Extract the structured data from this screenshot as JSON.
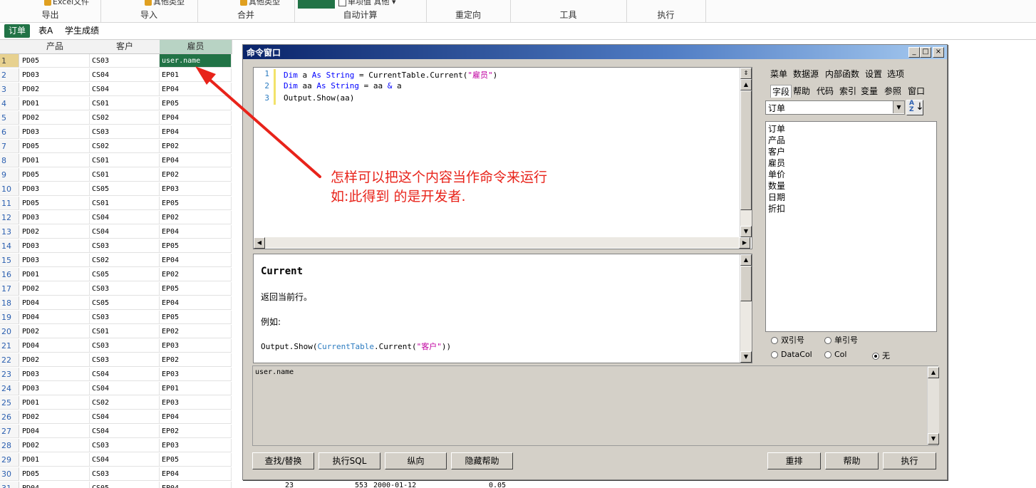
{
  "ribbon": {
    "groups": [
      {
        "label": "导出",
        "top_text": "Excel文件"
      },
      {
        "label": "导入",
        "top_text": "其他类型"
      },
      {
        "label": "合并",
        "top_text": "其他类型"
      },
      {
        "label": "自动计算",
        "top_text": "单项值 其他"
      },
      {
        "label": "重定向",
        "top_text": ""
      },
      {
        "label": "工具",
        "top_text": ""
      },
      {
        "label": "执行",
        "top_text": ""
      }
    ]
  },
  "tabs": [
    {
      "label": "订单",
      "active": true
    },
    {
      "label": "表A",
      "active": false
    },
    {
      "label": "学生成绩",
      "active": false
    }
  ],
  "grid": {
    "columns": [
      "产品",
      "客户",
      "雇员"
    ],
    "selected_column": "雇员",
    "rows": [
      {
        "n": "1",
        "product": "PD05",
        "customer": "CS03",
        "employee": "user.name"
      },
      {
        "n": "2",
        "product": "PD03",
        "customer": "CS04",
        "employee": "EP01"
      },
      {
        "n": "3",
        "product": "PD02",
        "customer": "CS04",
        "employee": "EP04"
      },
      {
        "n": "4",
        "product": "PD01",
        "customer": "CS01",
        "employee": "EP05"
      },
      {
        "n": "5",
        "product": "PD02",
        "customer": "CS02",
        "employee": "EP04"
      },
      {
        "n": "6",
        "product": "PD03",
        "customer": "CS03",
        "employee": "EP04"
      },
      {
        "n": "7",
        "product": "PD05",
        "customer": "CS02",
        "employee": "EP02"
      },
      {
        "n": "8",
        "product": "PD01",
        "customer": "CS01",
        "employee": "EP04"
      },
      {
        "n": "9",
        "product": "PD05",
        "customer": "CS01",
        "employee": "EP02"
      },
      {
        "n": "10",
        "product": "PD03",
        "customer": "CS05",
        "employee": "EP03"
      },
      {
        "n": "11",
        "product": "PD05",
        "customer": "CS01",
        "employee": "EP05"
      },
      {
        "n": "12",
        "product": "PD03",
        "customer": "CS04",
        "employee": "EP02"
      },
      {
        "n": "13",
        "product": "PD02",
        "customer": "CS04",
        "employee": "EP04"
      },
      {
        "n": "14",
        "product": "PD03",
        "customer": "CS03",
        "employee": "EP05"
      },
      {
        "n": "15",
        "product": "PD03",
        "customer": "CS02",
        "employee": "EP04"
      },
      {
        "n": "16",
        "product": "PD01",
        "customer": "CS05",
        "employee": "EP02"
      },
      {
        "n": "17",
        "product": "PD02",
        "customer": "CS03",
        "employee": "EP05"
      },
      {
        "n": "18",
        "product": "PD04",
        "customer": "CS05",
        "employee": "EP04"
      },
      {
        "n": "19",
        "product": "PD04",
        "customer": "CS03",
        "employee": "EP05"
      },
      {
        "n": "20",
        "product": "PD02",
        "customer": "CS01",
        "employee": "EP02"
      },
      {
        "n": "21",
        "product": "PD04",
        "customer": "CS03",
        "employee": "EP03"
      },
      {
        "n": "22",
        "product": "PD02",
        "customer": "CS03",
        "employee": "EP02"
      },
      {
        "n": "23",
        "product": "PD03",
        "customer": "CS04",
        "employee": "EP03"
      },
      {
        "n": "24",
        "product": "PD03",
        "customer": "CS04",
        "employee": "EP01"
      },
      {
        "n": "25",
        "product": "PD01",
        "customer": "CS02",
        "employee": "EP03"
      },
      {
        "n": "26",
        "product": "PD02",
        "customer": "CS04",
        "employee": "EP04"
      },
      {
        "n": "27",
        "product": "PD04",
        "customer": "CS04",
        "employee": "EP02"
      },
      {
        "n": "28",
        "product": "PD02",
        "customer": "CS03",
        "employee": "EP03"
      },
      {
        "n": "29",
        "product": "PD01",
        "customer": "CS04",
        "employee": "EP05"
      },
      {
        "n": "30",
        "product": "PD05",
        "customer": "CS03",
        "employee": "EP04"
      },
      {
        "n": "31",
        "product": "PD04",
        "customer": "CS05",
        "employee": "EP04"
      }
    ],
    "partial_bottom_values": [
      "23",
      "553",
      "2000-01-12",
      "0.05"
    ]
  },
  "dialog": {
    "title": "命令窗口",
    "window_buttons": {
      "minimize": "_",
      "maximize": "□",
      "close": "×"
    },
    "code_lines": [
      {
        "n": "1",
        "text": "Dim a As String = CurrentTable.Current(\"雇员\")"
      },
      {
        "n": "2",
        "text": "Dim aa As String = aa & a"
      },
      {
        "n": "3",
        "text": "Output.Show(aa)"
      }
    ],
    "help": {
      "title": "Current",
      "desc": "返回当前行。",
      "example_label": "例如:",
      "example_code": "Output.Show(CurrentTable.Current(\"客户\"))"
    },
    "right_tabs_row1": [
      "菜单",
      "数据源",
      "内部函数",
      "设置",
      "选项"
    ],
    "right_tabs_row2": [
      "字段",
      "帮助",
      "代码",
      "索引",
      "变量",
      "参照",
      "窗口"
    ],
    "active_right_tab": "字段",
    "table_select": "订单",
    "field_list": [
      "订单",
      "产品",
      "客户",
      "雇员",
      "单价",
      "数量",
      "日期",
      "折扣"
    ],
    "radios": [
      {
        "label": "双引号",
        "checked": false
      },
      {
        "label": "单引号",
        "checked": false
      },
      {
        "label": "DataCol",
        "checked": false
      },
      {
        "label": "Col",
        "checked": false
      },
      {
        "label": "无",
        "checked": true
      }
    ],
    "output": "user.name",
    "buttons_left": [
      "查找/替换",
      "执行SQL",
      "纵向",
      "隐藏帮助"
    ],
    "buttons_right": [
      "重排",
      "帮助",
      "执行"
    ]
  },
  "annotation": {
    "line1": "怎样可以把这个内容当作命令来运行",
    "line2": "如:此得到 的是开发者.",
    "color": "#e8231a"
  },
  "colors": {
    "accent": "#217346",
    "title_bar": "#0a246a",
    "annotation": "#e8231a"
  }
}
